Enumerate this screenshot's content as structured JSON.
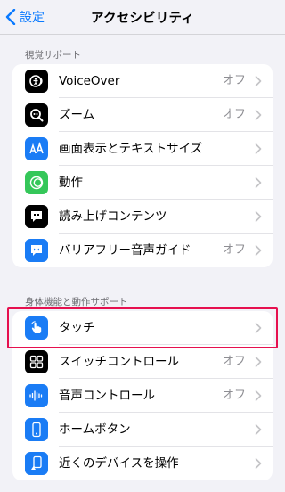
{
  "nav": {
    "back_label": "設定",
    "title": "アクセシビリティ"
  },
  "sections": [
    {
      "header": "視覚サポート",
      "items": [
        {
          "label": "VoiceOver",
          "value": "オフ",
          "icon": "voiceover-icon",
          "color": "#000000"
        },
        {
          "label": "ズーム",
          "value": "オフ",
          "icon": "zoom-icon",
          "color": "#000000"
        },
        {
          "label": "画面表示とテキストサイズ",
          "value": "",
          "icon": "text-size-icon",
          "color": "#1a7cf5"
        },
        {
          "label": "動作",
          "value": "",
          "icon": "motion-icon",
          "color": "#35c759"
        },
        {
          "label": "読み上げコンテンツ",
          "value": "",
          "icon": "spoken-content-icon",
          "color": "#000000"
        },
        {
          "label": "バリアフリー音声ガイド",
          "value": "オフ",
          "icon": "audio-description-icon",
          "color": "#1a7cf5"
        }
      ]
    },
    {
      "header": "身体機能と動作サポート",
      "items": [
        {
          "label": "タッチ",
          "value": "",
          "icon": "touch-hand-icon",
          "color": "#1a7cf5",
          "highlighted": true
        },
        {
          "label": "スイッチコントロール",
          "value": "オフ",
          "icon": "switch-control-icon",
          "color": "#000000"
        },
        {
          "label": "音声コントロール",
          "value": "オフ",
          "icon": "voice-control-icon",
          "color": "#1a7cf5"
        },
        {
          "label": "ホームボタン",
          "value": "",
          "icon": "home-button-icon",
          "color": "#1a7cf5"
        },
        {
          "label": "近くのデバイスを操作",
          "value": "",
          "icon": "nearby-devices-icon",
          "color": "#1a7cf5"
        }
      ]
    }
  ],
  "colors": {
    "accent": "#0a7aff",
    "highlight": "#e6104f",
    "background": "#f2f2f7"
  }
}
